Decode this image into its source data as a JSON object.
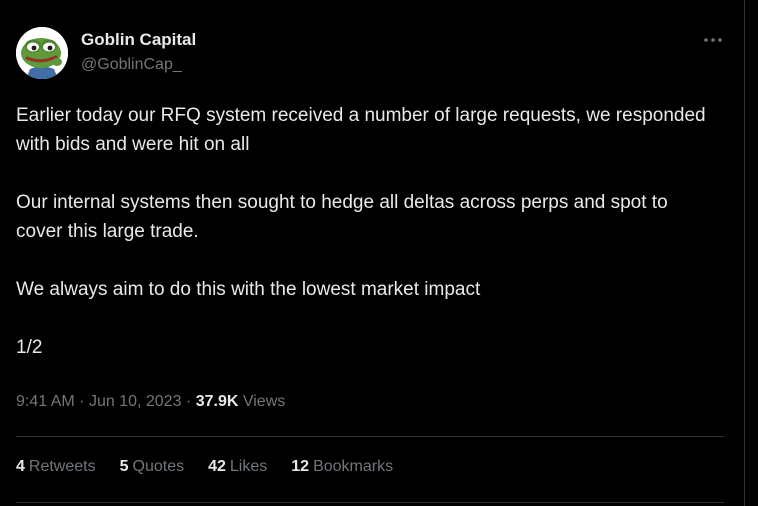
{
  "author": {
    "display_name": "Goblin Capital",
    "handle": "@GoblinCap_"
  },
  "tweet": {
    "paragraphs": [
      "Earlier today our RFQ system received a number of large requests, we responded with bids and were hit on all",
      "Our internal systems then sought to hedge all deltas across perps and spot to cover this large trade.",
      "We always aim to do this with the lowest market impact",
      "1/2"
    ]
  },
  "meta": {
    "time": "9:41 AM",
    "separator": "·",
    "date": "Jun 10, 2023",
    "views_count": "37.9K",
    "views_label": "Views"
  },
  "stats": [
    {
      "count": "4",
      "label": "Retweets"
    },
    {
      "count": "5",
      "label": "Quotes"
    },
    {
      "count": "42",
      "label": "Likes"
    },
    {
      "count": "12",
      "label": "Bookmarks"
    }
  ],
  "icons": {
    "more": "more-dots-icon",
    "avatar": "frog-avatar"
  },
  "colors": {
    "background": "#000000",
    "text_primary": "#e7e9ea",
    "text_secondary": "#71767b",
    "border": "#2f3336",
    "avatar_green": "#5e9a3a"
  }
}
